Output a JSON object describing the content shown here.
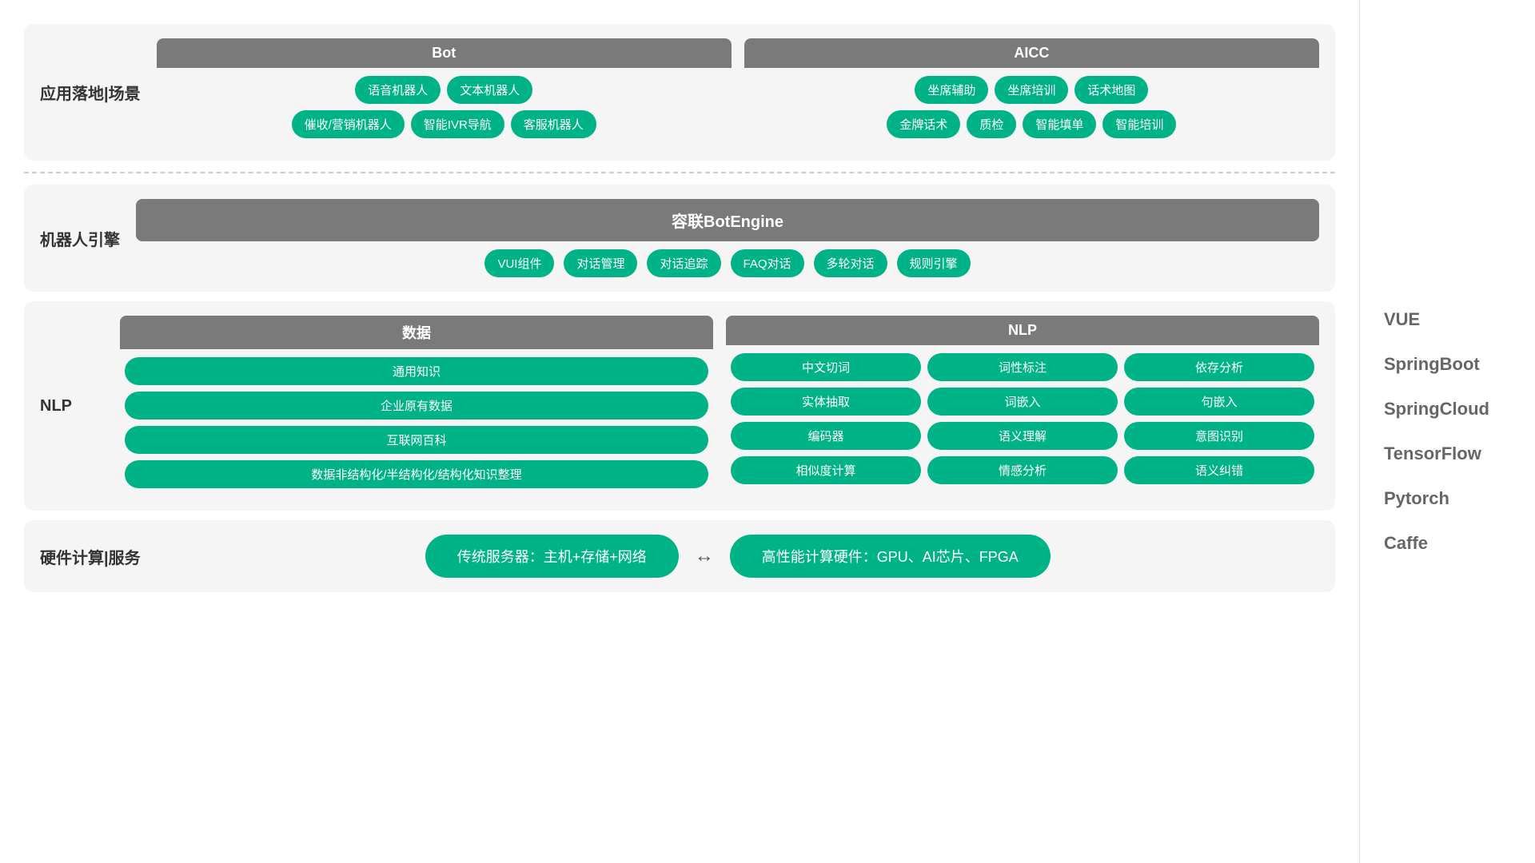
{
  "sidebar": {
    "items": [
      {
        "label": "VUE"
      },
      {
        "label": "SpringBoot"
      },
      {
        "label": "SpringCloud"
      },
      {
        "label": "TensorFlow"
      },
      {
        "label": "Pytorch"
      },
      {
        "label": "Caffe"
      }
    ]
  },
  "sections": {
    "app_scene": {
      "label": "应用落地|场景",
      "bot": {
        "header": "Bot",
        "row1": [
          "语音机器人",
          "文本机器人"
        ],
        "row2": [
          "催收/营销机器人",
          "智能IVR导航",
          "客服机器人"
        ]
      },
      "aicc": {
        "header": "AICC",
        "row1": [
          "坐席辅助",
          "坐席培训",
          "话术地图"
        ],
        "row2": [
          "金牌话术",
          "质检",
          "智能填单",
          "智能培训"
        ]
      }
    },
    "robot_engine": {
      "label": "机器人引擎",
      "engine_name": "容联BotEngine",
      "tags": [
        "VUI组件",
        "对话管理",
        "对话追踪",
        "FAQ对话",
        "多轮对话",
        "规则引擎"
      ]
    },
    "nlp": {
      "label": "NLP",
      "data": {
        "header": "数据",
        "rows": [
          "通用知识",
          "企业原有数据",
          "互联网百科",
          "数据非结构化/半结构化/结构化知识整理"
        ]
      },
      "nlp_sub": {
        "header": "NLP",
        "grid": [
          "中文切词",
          "词性标注",
          "依存分析",
          "实体抽取",
          "词嵌入",
          "句嵌入",
          "编码器",
          "语义理解",
          "意图识别",
          "相似度计算",
          "情感分析",
          "语义纠错"
        ]
      }
    },
    "hardware": {
      "label": "硬件计算|服务",
      "left": "传统服务器：主机+存储+网络",
      "right": "高性能计算硬件：GPU、AI芯片、FPGA"
    }
  }
}
